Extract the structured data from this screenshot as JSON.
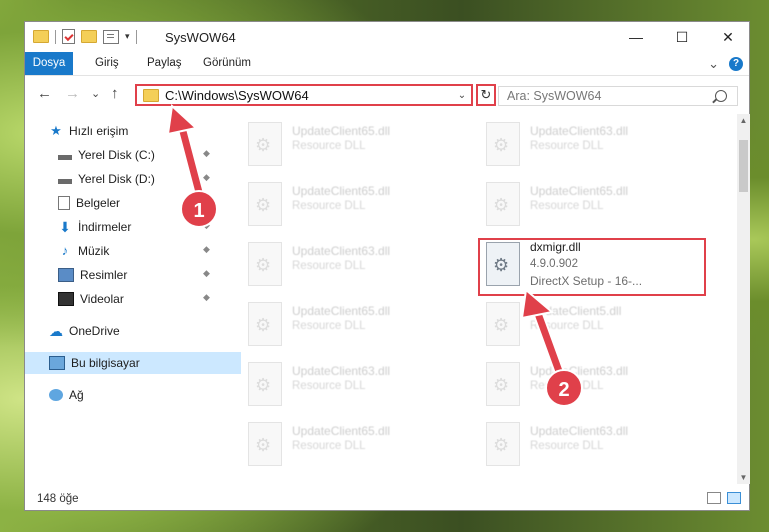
{
  "window": {
    "title": "SysWOW64",
    "minimize": "—",
    "maximize": "☐",
    "close": "✕"
  },
  "ribbon": {
    "tabs": [
      "Dosya",
      "Giriş",
      "Paylaş",
      "Görünüm"
    ],
    "expand_glyph": "⌄",
    "help_glyph": "?"
  },
  "navigation": {
    "back_glyph": "←",
    "forward_glyph": "→",
    "recent_glyph": "⌄",
    "up_glyph": "↑",
    "address_path": "C:\\Windows\\SysWOW64",
    "address_chevron": "⌄",
    "refresh_glyph": "↻",
    "search_placeholder": "Ara: SysWOW64"
  },
  "sidebar": {
    "items": [
      {
        "label": "Hızlı erişim",
        "icon": "star-icon"
      },
      {
        "label": "Yerel Disk (C:)",
        "icon": "drive-icon",
        "pinned": true
      },
      {
        "label": "Yerel Disk (D:)",
        "icon": "drive-icon",
        "pinned": true
      },
      {
        "label": "Belgeler",
        "icon": "document-icon",
        "pinned": true
      },
      {
        "label": "İndirmeler",
        "icon": "download-icon",
        "pinned": true
      },
      {
        "label": "Müzik",
        "icon": "music-icon",
        "pinned": true
      },
      {
        "label": "Resimler",
        "icon": "pictures-icon",
        "pinned": true
      },
      {
        "label": "Videolar",
        "icon": "videos-icon",
        "pinned": true
      },
      {
        "label": "OneDrive",
        "icon": "cloud-icon"
      },
      {
        "label": "Bu bilgisayar",
        "icon": "computer-icon",
        "selected": true
      },
      {
        "label": "Ağ",
        "icon": "network-icon"
      }
    ],
    "pin_glyph": "📌"
  },
  "files": {
    "left_column": [
      {
        "name": "UpdateClient65.dll",
        "type": "Resource DLL"
      },
      {
        "name": "UpdateClient65.dll",
        "type": "Resource DLL"
      },
      {
        "name": "UpdateClient63.dll",
        "type": "Resource DLL"
      },
      {
        "name": "UpdateClient65.dll",
        "type": "Resource DLL"
      },
      {
        "name": "UpdateClient63.dll",
        "type": "Resource DLL"
      },
      {
        "name": "UpdateClient65.dll",
        "type": "Resource DLL"
      }
    ],
    "right_column": [
      {
        "name": "UpdateClient63.dll",
        "type": "Resource DLL"
      },
      {
        "name": "UpdateClient65.dll",
        "type": "Resource DLL"
      },
      {
        "name": "UpdateClient5.dll",
        "type": "Resource DLL"
      },
      {
        "name": "UpdateClient63.dll",
        "type": "Resource DLL"
      },
      {
        "name": "UpdateClient63.dll",
        "type": "Resource DLL"
      }
    ],
    "focused": {
      "name": "dxmigr.dll",
      "version": "4.9.0.902",
      "description": "DirectX Setup - 16-..."
    }
  },
  "status": {
    "item_count": "148 öğe"
  },
  "annotations": {
    "first": "1",
    "second": "2",
    "color": "#e0404a"
  }
}
